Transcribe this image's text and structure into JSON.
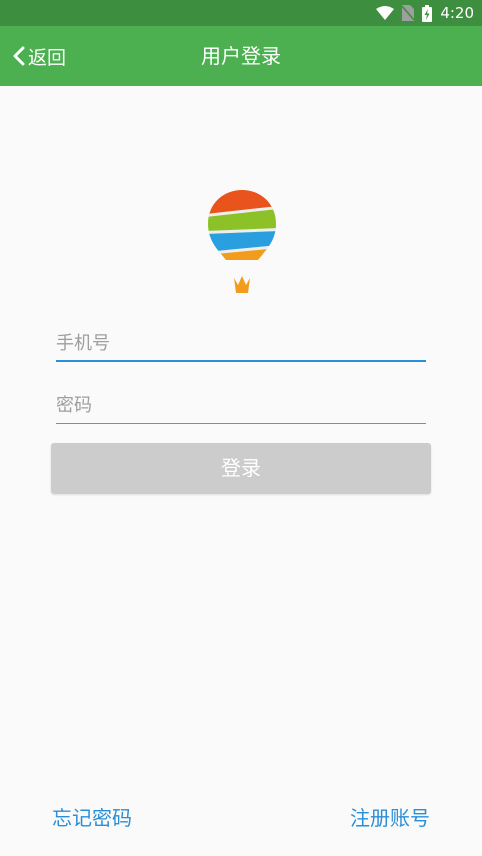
{
  "status_bar": {
    "time": "4:20",
    "icons": [
      "wifi-icon",
      "no-sim-icon",
      "battery-charging-icon"
    ]
  },
  "app_bar": {
    "back_label": "返回",
    "title": "用户登录",
    "color": "#4caf50"
  },
  "form": {
    "phone_placeholder": "手机号",
    "password_placeholder": "密码",
    "login_label": "登录"
  },
  "footer": {
    "forgot_password": "忘记密码",
    "register": "注册账号",
    "link_color": "#2a8fd6"
  }
}
